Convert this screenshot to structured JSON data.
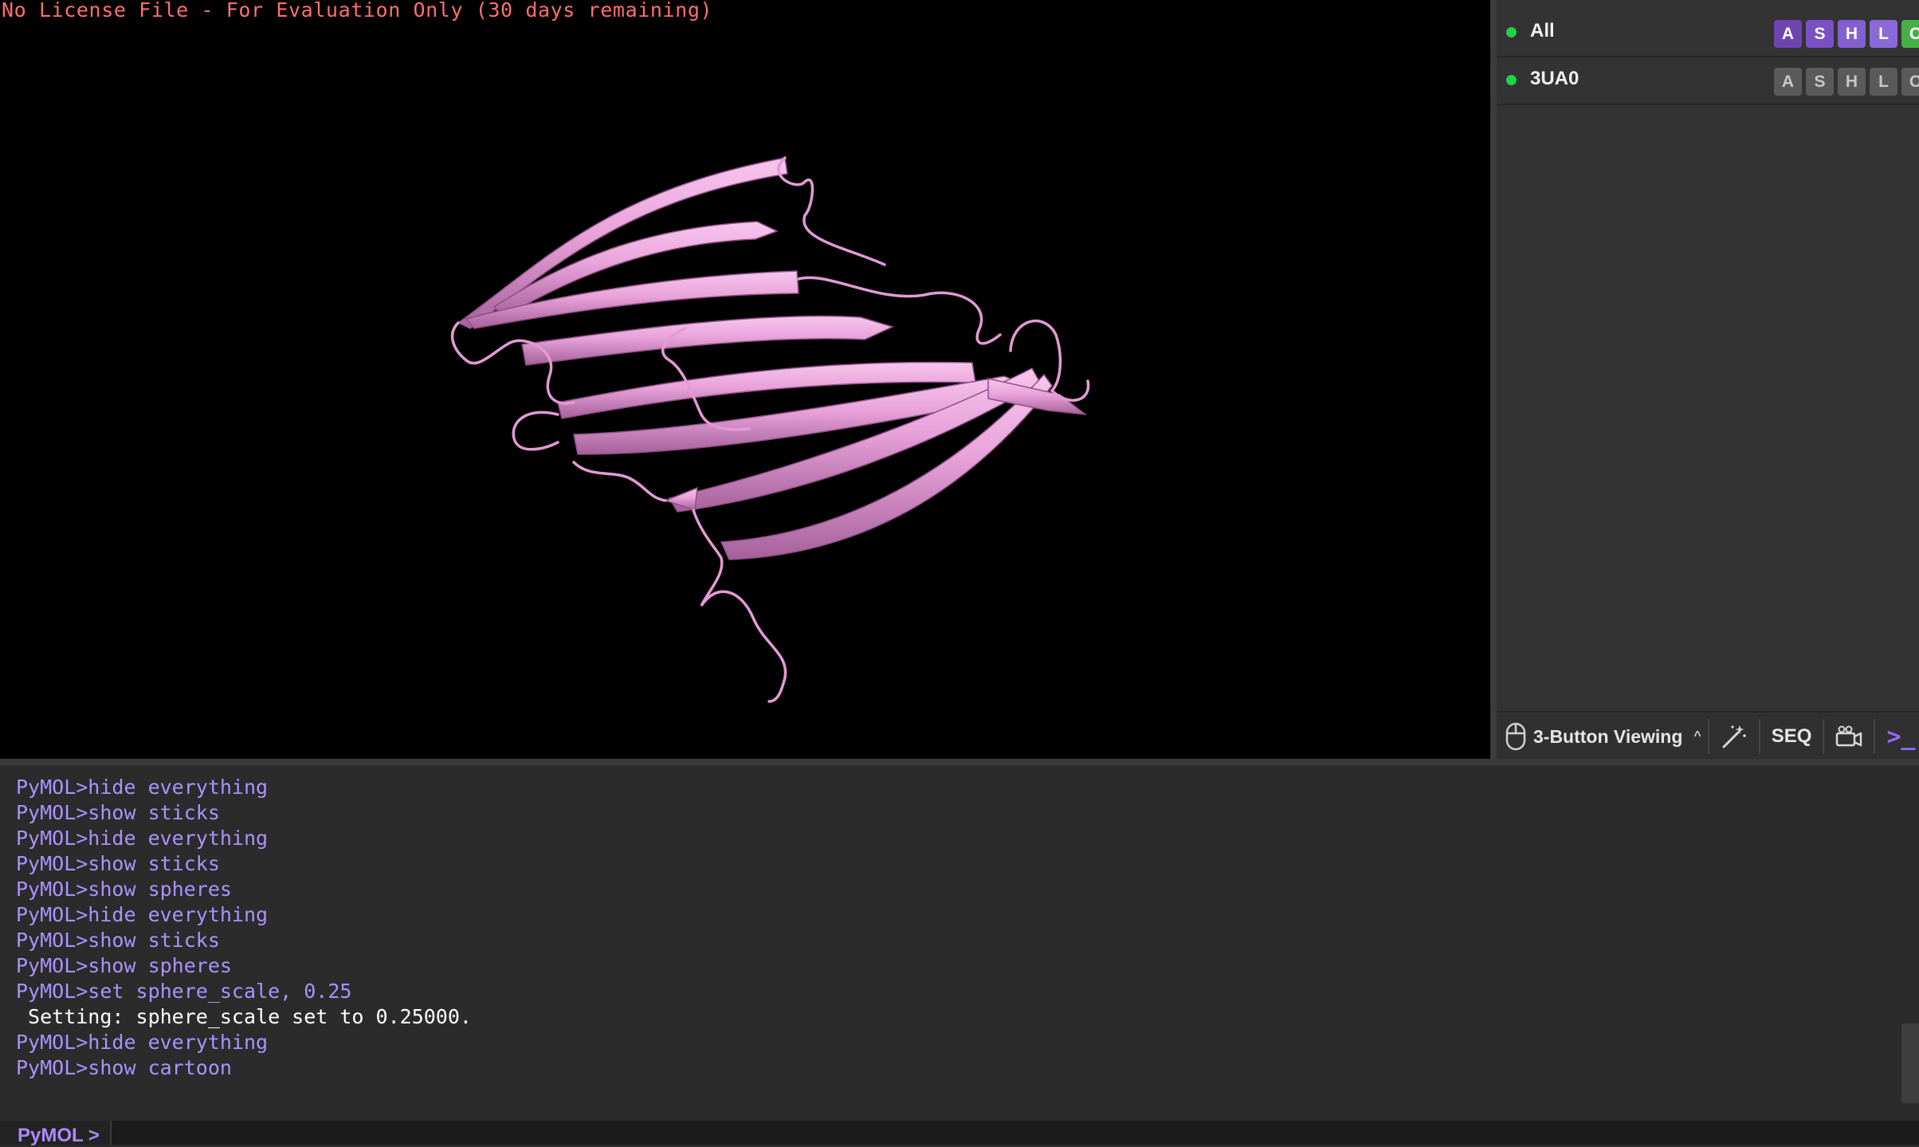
{
  "viewport": {
    "license_notice": "No License File - For Evaluation Only (30 days remaining)",
    "representation": "cartoon",
    "cartoon_color": "#e7a2d8"
  },
  "objects_panel": {
    "rows": [
      {
        "name": "All",
        "enabled": true,
        "buttons": [
          "A",
          "S",
          "H",
          "L",
          "C"
        ],
        "active": true
      },
      {
        "name": "3UA0",
        "enabled": true,
        "buttons": [
          "A",
          "S",
          "H",
          "L",
          "C"
        ],
        "active": false
      }
    ],
    "bottom_bar": {
      "mouse_mode": "3-Button Viewing",
      "mouse_mode_icon": "mouse-icon",
      "caret_icon": "chevron-up-icon",
      "wizard_icon": "magic-wand-icon",
      "seq_label": "SEQ",
      "movie_icon": "movie-camera-icon",
      "prompt_toggle": ">_"
    }
  },
  "console": {
    "lines": [
      {
        "text": "PyMOL>hide everything",
        "kind": "cmd"
      },
      {
        "text": "PyMOL>show sticks",
        "kind": "cmd"
      },
      {
        "text": "PyMOL>hide everything",
        "kind": "cmd"
      },
      {
        "text": "PyMOL>show sticks",
        "kind": "cmd"
      },
      {
        "text": "PyMOL>show spheres",
        "kind": "cmd"
      },
      {
        "text": "PyMOL>hide everything",
        "kind": "cmd"
      },
      {
        "text": "PyMOL>show sticks",
        "kind": "cmd"
      },
      {
        "text": "PyMOL>show spheres",
        "kind": "cmd"
      },
      {
        "text": "PyMOL>set sphere_scale, 0.25",
        "kind": "cmd"
      },
      {
        "text": " Setting: sphere_scale set to 0.25000.",
        "kind": "out"
      },
      {
        "text": "PyMOL>hide everything",
        "kind": "cmd"
      },
      {
        "text": "PyMOL>show cartoon",
        "kind": "cmd"
      }
    ],
    "prompt_label": "PyMOL >",
    "input_value": ""
  },
  "colors": {
    "accent_purple": "#8f6bff",
    "enabled_dot": "#22d04a",
    "license_text": "#ff6f6f"
  }
}
